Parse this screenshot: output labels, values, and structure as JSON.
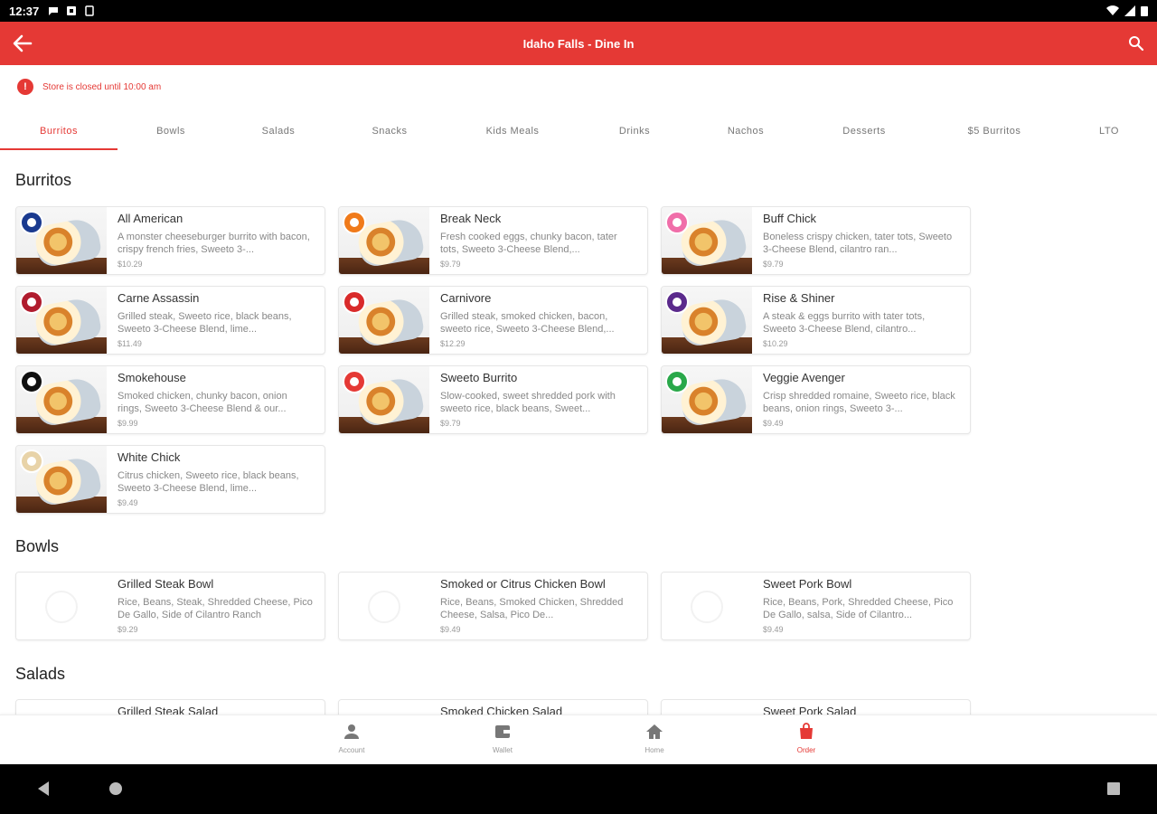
{
  "status_bar": {
    "time": "12:37"
  },
  "app_bar": {
    "title": "Idaho Falls - Dine In"
  },
  "notice": {
    "icon": "!",
    "text": "Store is closed until 10:00 am"
  },
  "colors": {
    "accent": "#e53935"
  },
  "tabs": [
    {
      "label": "Burritos",
      "active": true
    },
    {
      "label": "Bowls"
    },
    {
      "label": "Salads"
    },
    {
      "label": "Snacks"
    },
    {
      "label": "Kids Meals"
    },
    {
      "label": "Drinks"
    },
    {
      "label": "Nachos"
    },
    {
      "label": "Desserts"
    },
    {
      "label": "$5 Burritos"
    },
    {
      "label": "LTO"
    }
  ],
  "sections": {
    "burritos": {
      "title": "Burritos",
      "items": [
        {
          "name": "All American",
          "desc": "A monster cheeseburger burrito with bacon, crispy french fries, Sweeto 3-...",
          "price": "$10.29",
          "badge_color": "#1a3a8f"
        },
        {
          "name": "Break Neck",
          "desc": "Fresh cooked eggs, chunky bacon, tater tots, Sweeto 3-Cheese Blend,...",
          "price": "$9.79",
          "badge_color": "#f07a1a"
        },
        {
          "name": "Buff Chick",
          "desc": "Boneless crispy chicken, tater tots, Sweeto 3-Cheese Blend, cilantro ran...",
          "price": "$9.79",
          "badge_color": "#f06ea9"
        },
        {
          "name": "Carne Assassin",
          "desc": "Grilled steak, Sweeto rice, black beans, Sweeto 3-Cheese Blend, lime...",
          "price": "$11.49",
          "badge_color": "#b01c2e"
        },
        {
          "name": "Carnivore",
          "desc": "Grilled steak, smoked chicken, bacon, sweeto rice, Sweeto 3-Cheese Blend,...",
          "price": "$12.29",
          "badge_color": "#d92a2a"
        },
        {
          "name": "Rise & Shiner",
          "desc": "A steak & eggs burrito with tater tots, Sweeto 3-Cheese Blend, cilantro...",
          "price": "$10.29",
          "badge_color": "#5b2a8c"
        },
        {
          "name": "Smokehouse",
          "desc": "Smoked chicken, chunky bacon, onion rings, Sweeto 3-Cheese Blend & our...",
          "price": "$9.99",
          "badge_color": "#111111"
        },
        {
          "name": "Sweeto Burrito",
          "desc": "Slow-cooked, sweet shredded pork with sweeto rice, black beans, Sweet...",
          "price": "$9.79",
          "badge_color": "#e53935"
        },
        {
          "name": "Veggie Avenger",
          "desc": "Crisp shredded romaine, Sweeto rice, black beans, onion rings, Sweeto 3-...",
          "price": "$9.49",
          "badge_color": "#2aa84a"
        },
        {
          "name": "White Chick",
          "desc": "Citrus chicken, Sweeto rice, black beans, Sweeto 3-Cheese Blend, lime...",
          "price": "$9.49",
          "badge_color": "#e8d3a8"
        }
      ]
    },
    "bowls": {
      "title": "Bowls",
      "items": [
        {
          "name": "Grilled Steak Bowl",
          "desc": "Rice, Beans, Steak, Shredded Cheese, Pico De Gallo, Side of Cilantro Ranch",
          "price": "$9.29"
        },
        {
          "name": "Smoked or Citrus Chicken Bowl",
          "desc": "Rice, Beans, Smoked Chicken, Shredded Cheese, Salsa, Pico De...",
          "price": "$9.49"
        },
        {
          "name": "Sweet Pork Bowl",
          "desc": "Rice, Beans, Pork, Shredded Cheese, Pico De Gallo, salsa, Side of Cilantro...",
          "price": "$9.49"
        }
      ]
    },
    "salads": {
      "title": "Salads",
      "items": [
        {
          "name": "Grilled Steak Salad"
        },
        {
          "name": "Smoked Chicken Salad"
        },
        {
          "name": "Sweet Pork Salad"
        }
      ]
    }
  },
  "bottom_nav": [
    {
      "label": "Account",
      "icon": "person-icon"
    },
    {
      "label": "Wallet",
      "icon": "wallet-icon"
    },
    {
      "label": "Home",
      "icon": "home-icon"
    },
    {
      "label": "Order",
      "icon": "bag-icon",
      "active": true
    }
  ]
}
